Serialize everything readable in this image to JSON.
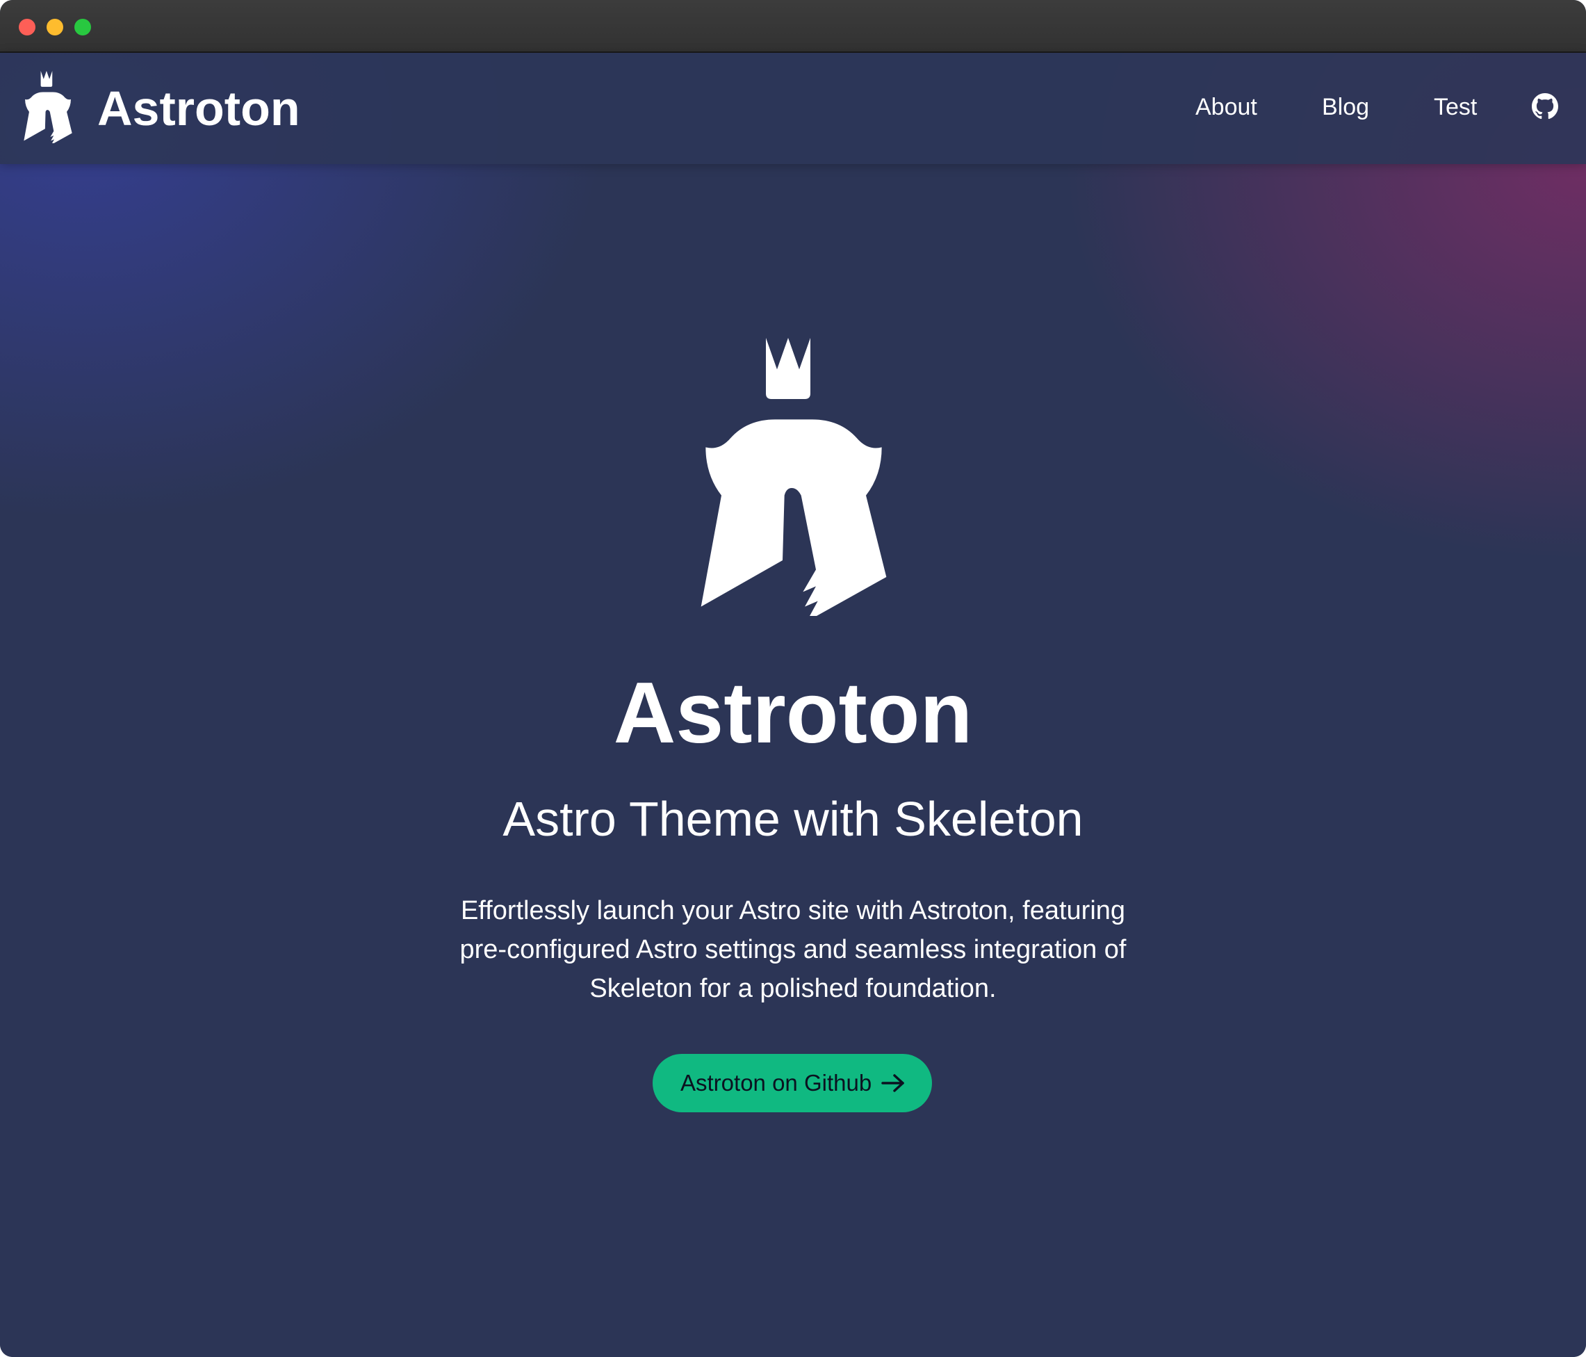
{
  "window": {
    "controls": [
      "close",
      "minimize",
      "zoom"
    ]
  },
  "navbar": {
    "logo_icon": "astroton-logo-icon",
    "brand": "Astroton",
    "links": [
      {
        "label": "About"
      },
      {
        "label": "Blog"
      },
      {
        "label": "Test"
      }
    ],
    "github_icon": "github-icon"
  },
  "hero": {
    "logo_icon": "astroton-logo-icon",
    "title": "Astroton",
    "subtitle": "Astro Theme with Skeleton",
    "description": "Effortlessly launch your Astro site with Astroton, featuring pre-configured Astro settings and seamless integration of Skeleton for a polished foundation.",
    "cta": {
      "label": "Astroton on Github",
      "icon": "arrow-right-icon"
    }
  },
  "colors": {
    "background": "#2c3556",
    "accent": "#10b981",
    "gradient_left": "#3c46be",
    "gradient_right": "#a5286e",
    "text": "#ffffff"
  }
}
